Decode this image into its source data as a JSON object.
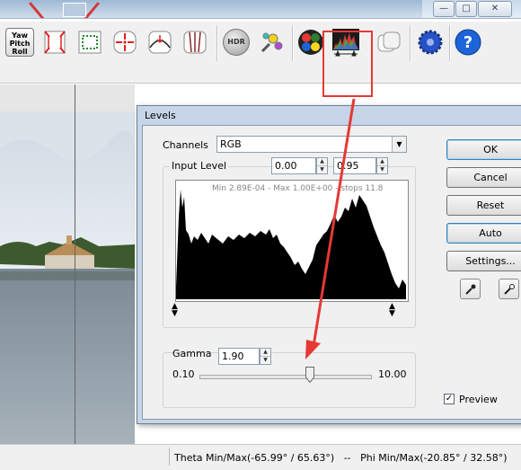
{
  "toolbar": {
    "ypr_lines": [
      "Yaw",
      "Pitch",
      "Roll"
    ],
    "hdr_label": "HDR"
  },
  "window_buttons": {
    "minimize": "—",
    "maximize": "□",
    "close": "✕"
  },
  "levels_dialog": {
    "title": "Levels",
    "channels_label": "Channels",
    "channel_value": "RGB",
    "input_level_label": "Input Level",
    "input_min": "0.00",
    "input_max": "0.95",
    "histogram_stats": "Min 2.89E-04 - Max 1.00E+00 - stops 11.8",
    "gamma_label": "Gamma",
    "gamma_value": "1.90",
    "gamma_min": "0.10",
    "gamma_max": "10.00",
    "gamma_level": 1.9,
    "buttons": {
      "ok": "OK",
      "cancel": "Cancel",
      "reset": "Reset",
      "auto": "Auto",
      "settings": "Settings..."
    },
    "preview_label": "Preview",
    "preview_checked": true
  },
  "status": {
    "text": "Theta Min/Max(-65.99° / 65.63°)   --   Phi Min/Max(-20.85° / 32.58°)"
  },
  "colors": {
    "highlight": "#e53935",
    "dialog_frame": "#c6d6e8",
    "toolbar_bg": "#f0f0f0"
  },
  "icons": [
    "yaw-pitch-roll-icon",
    "fit-horizontal-icon",
    "crop-icon",
    "center-point-icon",
    "straighten-horizon-icon",
    "vertical-lines-icon",
    "hdr-icon",
    "color-picker-icon",
    "color-balance-icon",
    "levels-histogram-icon",
    "blend-icon",
    "settings-gear-icon",
    "help-icon"
  ]
}
